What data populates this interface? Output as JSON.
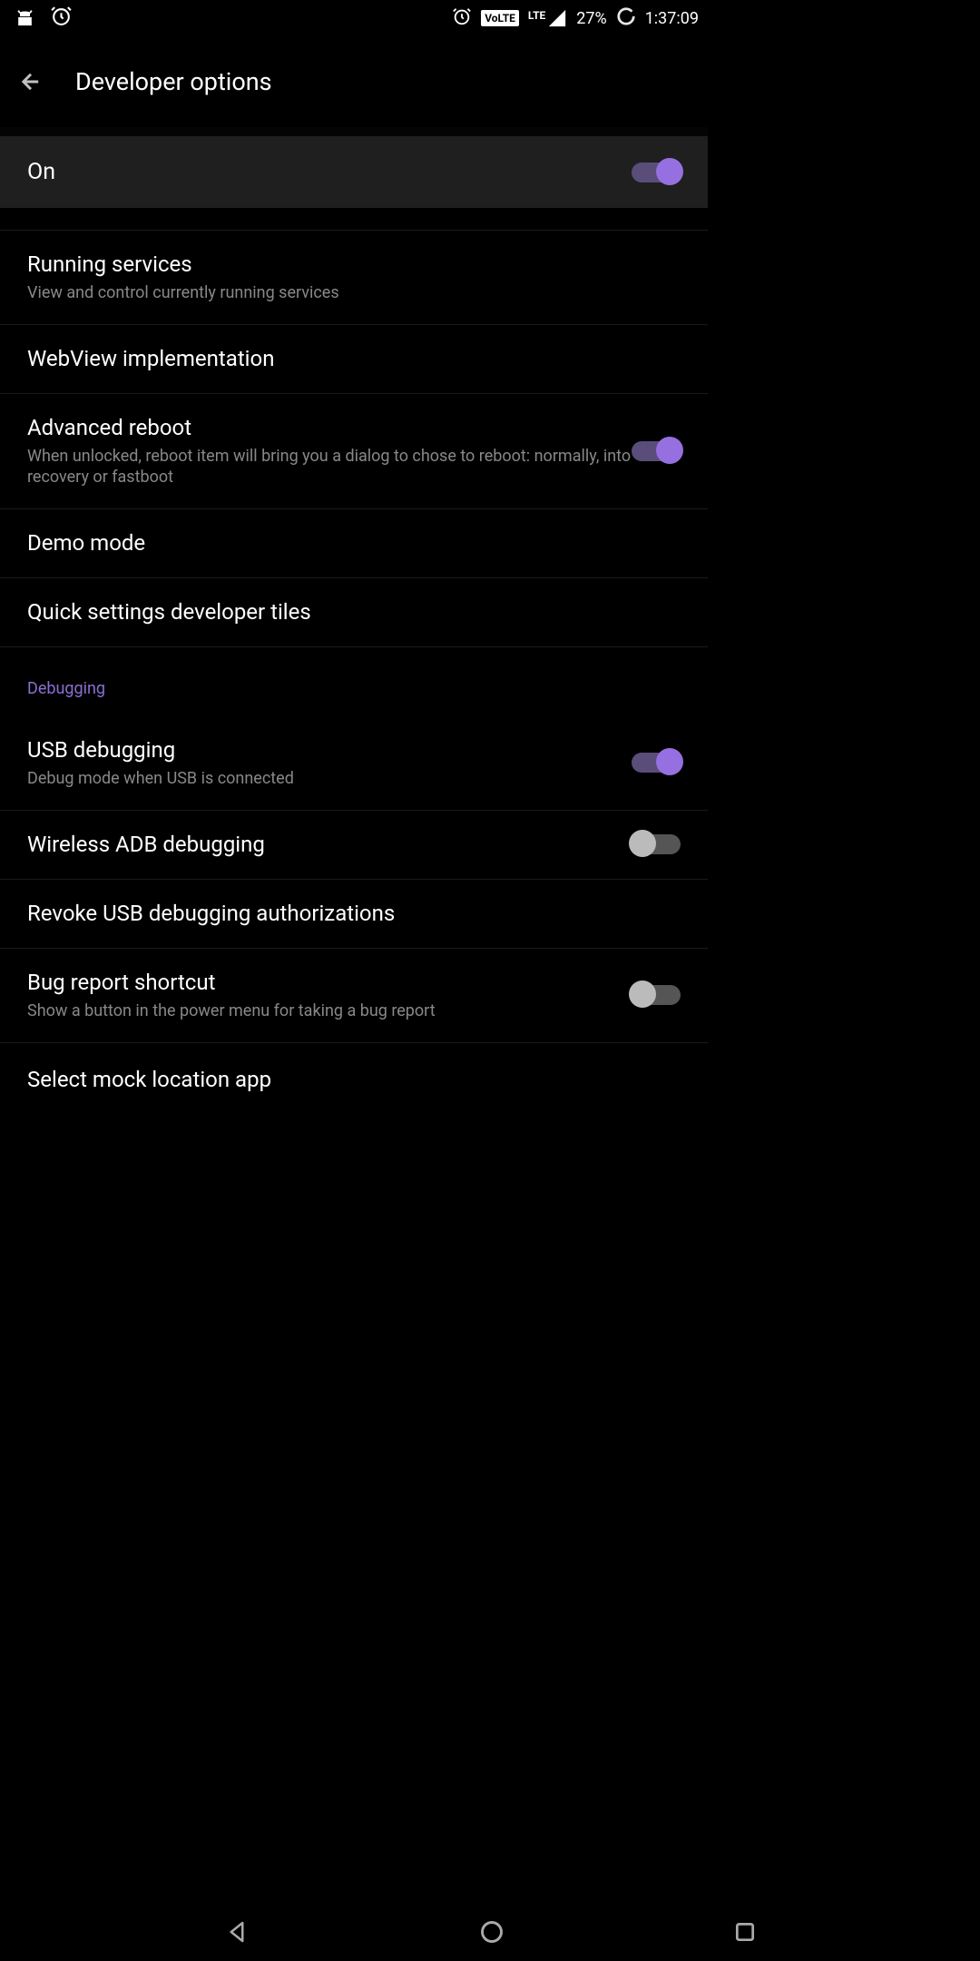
{
  "statusBar": {
    "battery": "27%",
    "time": "1:37:09",
    "volte": "VoLTE",
    "networkLabel": "LTE"
  },
  "appBar": {
    "title": "Developer options"
  },
  "masterToggle": {
    "label": "On",
    "enabled": true
  },
  "sections": {
    "debugging": "Debugging"
  },
  "items": {
    "runningServices": {
      "title": "Running services",
      "subtitle": "View and control currently running services"
    },
    "webview": {
      "title": "WebView implementation"
    },
    "advancedReboot": {
      "title": "Advanced reboot",
      "subtitle": "When unlocked, reboot item will bring you a dialog to chose to reboot: normally, into recovery or fastboot",
      "enabled": true
    },
    "demoMode": {
      "title": "Demo mode"
    },
    "quickSettings": {
      "title": "Quick settings developer tiles"
    },
    "usbDebugging": {
      "title": "USB debugging",
      "subtitle": "Debug mode when USB is connected",
      "enabled": true
    },
    "wirelessAdb": {
      "title": "Wireless ADB debugging",
      "enabled": false
    },
    "revokeUsb": {
      "title": "Revoke USB debugging authorizations"
    },
    "bugReport": {
      "title": "Bug report shortcut",
      "subtitle": "Show a button in the power menu for taking a bug report",
      "enabled": false
    },
    "mockLocation": {
      "title": "Select mock location app"
    }
  }
}
